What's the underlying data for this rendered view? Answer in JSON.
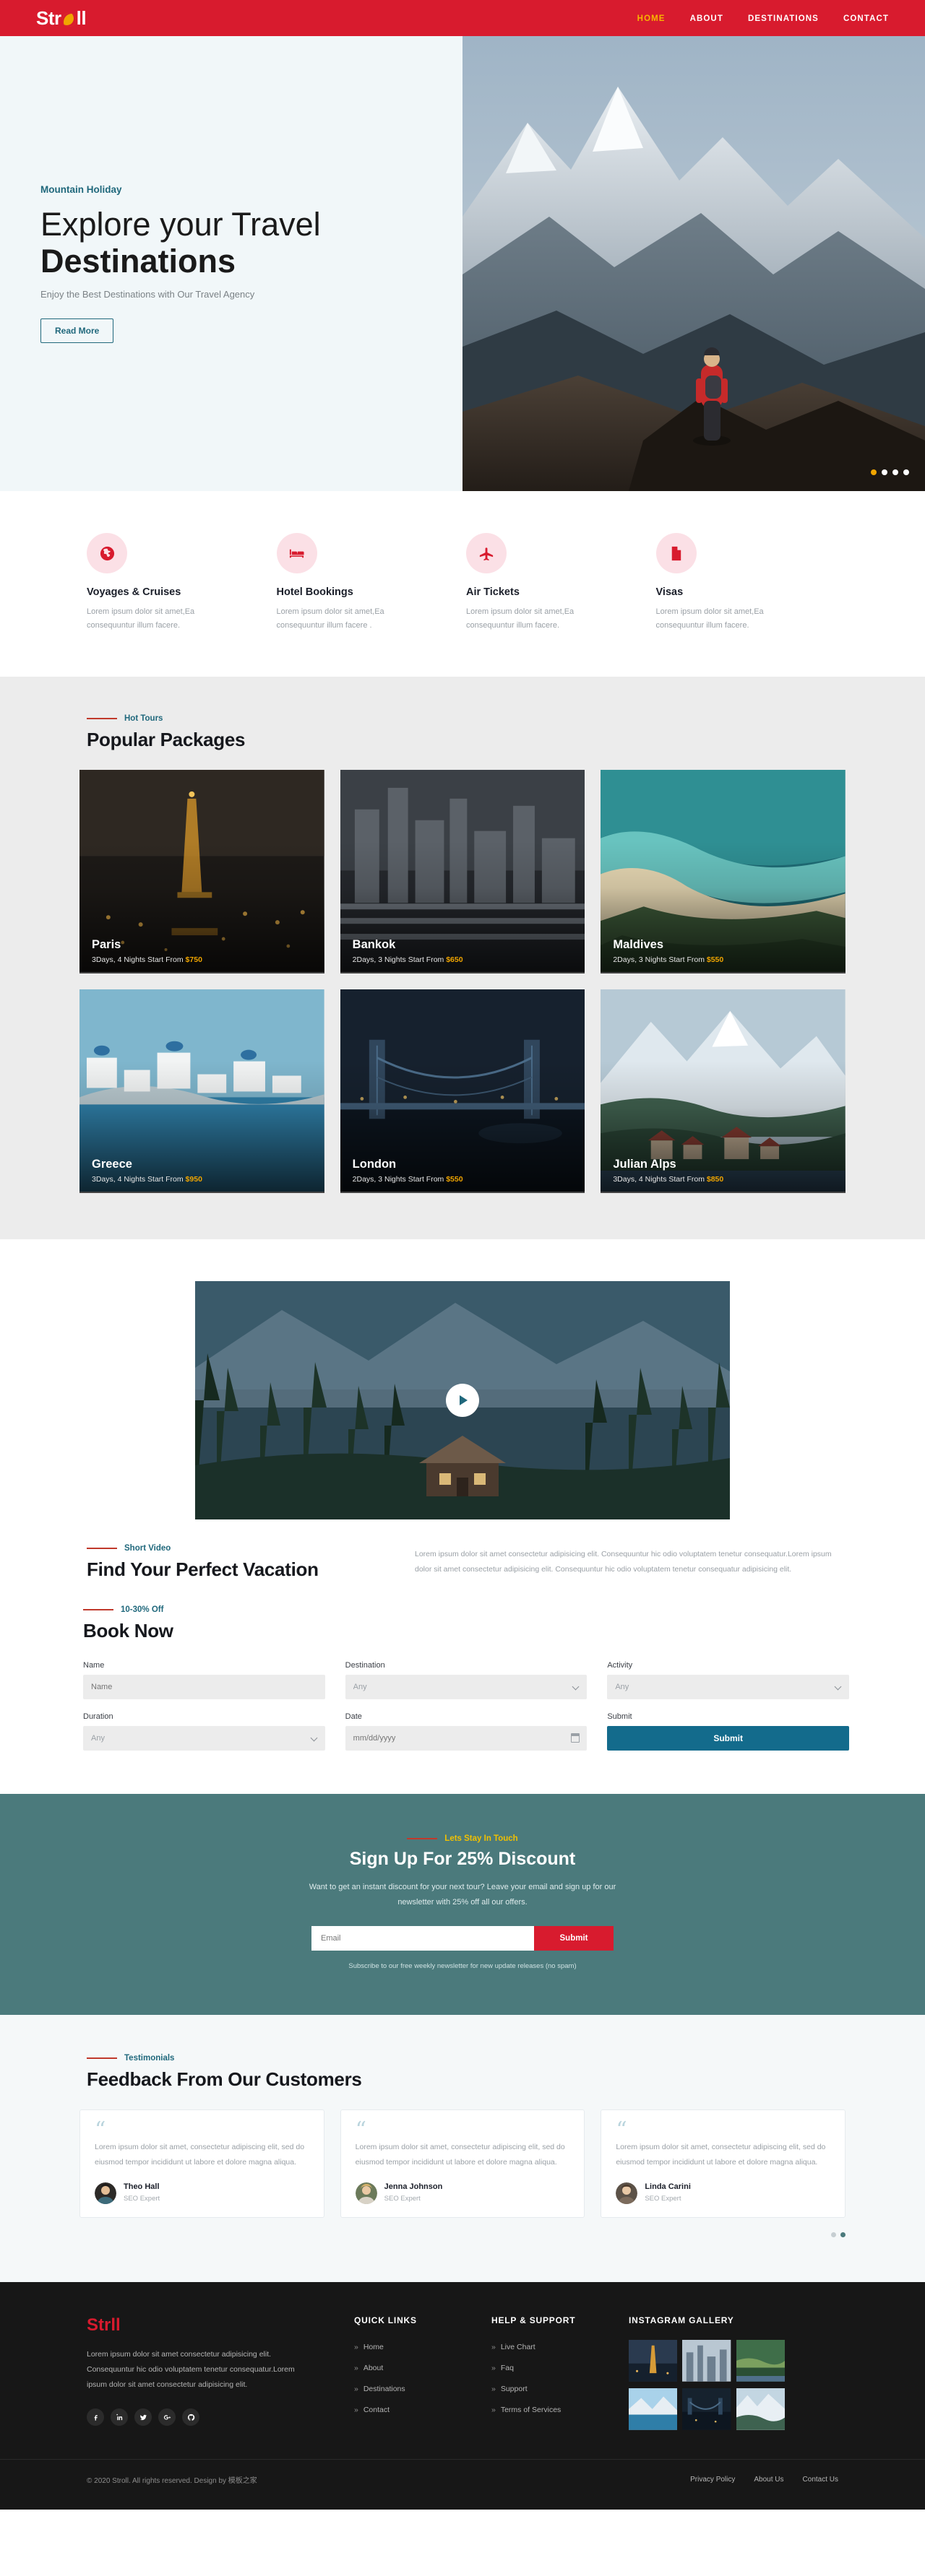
{
  "brand": {
    "name_a": "Str",
    "name_b": "ll",
    "globe_icon": "globe-icon"
  },
  "nav": {
    "items": [
      {
        "label": "HOME",
        "active": true
      },
      {
        "label": "ABOUT",
        "active": false
      },
      {
        "label": "DESTINATIONS",
        "active": false
      },
      {
        "label": "CONTACT",
        "active": false
      }
    ]
  },
  "hero": {
    "kicker": "Mountain Holiday",
    "title_line1": "Explore your Travel",
    "title_line2": "Destinations",
    "subtitle": "Enjoy the Best Destinations with Our Travel Agency",
    "button": "Read More",
    "slider_dots": 4,
    "active_dot": 1,
    "accent_color": "#f0a500"
  },
  "services": [
    {
      "icon": "globe-icon",
      "title": "Voyages & Cruises",
      "desc": "Lorem ipsum dolor sit amet,Ea consequuntur illum facere."
    },
    {
      "icon": "bed-icon",
      "title": "Hotel Bookings",
      "desc": "Lorem ipsum dolor sit amet,Ea consequuntur illum facere ."
    },
    {
      "icon": "plane-icon",
      "title": "Air Tickets",
      "desc": "Lorem ipsum dolor sit amet,Ea consequuntur illum facere."
    },
    {
      "icon": "document-icon",
      "title": "Visas",
      "desc": "Lorem ipsum dolor sit amet,Ea consequuntur illum facere."
    }
  ],
  "packages": {
    "label": "Hot Tours",
    "title": "Popular Packages",
    "items": [
      {
        "name": "Paris",
        "meta": "3Days, 4 Nights Start From ",
        "price": "$750",
        "img": "paris"
      },
      {
        "name": "Bankok",
        "meta": "2Days, 3 Nights Start From ",
        "price": "$650",
        "img": "bankok"
      },
      {
        "name": "Maldives",
        "meta": "2Days, 3 Nights Start From ",
        "price": "$550",
        "img": "maldives"
      },
      {
        "name": "Greece",
        "meta": "3Days, 4 Nights Start From ",
        "price": "$950",
        "img": "greece"
      },
      {
        "name": "London",
        "meta": "2Days, 3 Nights Start From ",
        "price": "$550",
        "img": "london"
      },
      {
        "name": "Julian Alps",
        "meta": "3Days, 4 Nights Start From ",
        "price": "$850",
        "img": "alps"
      }
    ]
  },
  "video": {
    "label": "Short Video",
    "title": "Find Your Perfect Vacation",
    "paragraph": "Lorem ipsum dolor sit amet consectetur adipisicing elit. Consequuntur hic odio voluptatem tenetur consequatur.Lorem ipsum dolor sit amet consectetur adipisicing elit. Consequuntur hic odio voluptatem tenetur consequatur adipisicing elit.",
    "play_icon": "play-icon"
  },
  "book": {
    "label": "10-30% Off",
    "title": "Book Now",
    "fields": [
      {
        "label": "Name",
        "type": "text",
        "value": "",
        "placeholder": "Name"
      },
      {
        "label": "Destination",
        "type": "select",
        "value": "Any"
      },
      {
        "label": "Activity",
        "type": "select",
        "value": "Any"
      },
      {
        "label": "Duration",
        "type": "select",
        "value": "Any"
      },
      {
        "label": "Date",
        "type": "date",
        "value": "",
        "placeholder": "mm/dd/yyyy"
      }
    ],
    "submit_label": "Submit",
    "submit_field_label": "Submit",
    "submit_color": "#136b8c"
  },
  "newsletter": {
    "label": "Lets Stay In Touch",
    "title": "Sign Up For 25% Discount",
    "desc": "Want to get an instant discount for your next tour? Leave your email and sign up for our newsletter with 25% off all our offers.",
    "placeholder": "Email",
    "value": "",
    "submit_label": "Submit",
    "fine_print": "Subscribe to our free weekly newsletter for new update releases (no spam)",
    "bg_color": "#4b7a7c",
    "label_color": "#f0c000"
  },
  "testimonials": {
    "label": "Testimonials",
    "title": "Feedback From Our Customers",
    "items": [
      {
        "quote": "Lorem ipsum dolor sit amet, consectetur adipiscing elit, sed do eiusmod tempor incididunt ut labore et dolore magna aliqua.",
        "name": "Theo Hall",
        "role": "SEO Expert"
      },
      {
        "quote": "Lorem ipsum dolor sit amet, consectetur adipiscing elit, sed do eiusmod tempor incididunt ut labore et dolore magna aliqua.",
        "name": "Jenna Johnson",
        "role": "SEO Expert"
      },
      {
        "quote": "Lorem ipsum dolor sit amet, consectetur adipiscing elit, sed do eiusmod tempor incididunt ut labore et dolore magna aliqua.",
        "name": "Linda Carini",
        "role": "SEO Expert"
      }
    ],
    "dots": 2,
    "active_dot": 2
  },
  "footer": {
    "desc": "Lorem ipsum dolor sit amet consectetur adipisicing elit. Consequuntur hic odio voluptatem tenetur consequatur.Lorem ipsum dolor sit amet consectetur adipisicing elit.",
    "socials": [
      "facebook-icon",
      "linkedin-icon",
      "twitter-icon",
      "google-plus-icon",
      "github-icon"
    ],
    "quick_links_title": "QUICK LINKS",
    "quick_links": [
      "Home",
      "About",
      "Destinations",
      "Contact"
    ],
    "help_title": "HELP & SUPPORT",
    "help_links": [
      "Live Chart",
      "Faq",
      "Support",
      "Terms of Services"
    ],
    "instagram_title": "INSTAGRAM GALLERY",
    "instagram_count": 6,
    "copyright": "© 2020 Stroll. All rights reserved. Design by 模板之家",
    "bottom_links": [
      "Privacy Policy",
      "About Us",
      "Contact Us"
    ]
  }
}
